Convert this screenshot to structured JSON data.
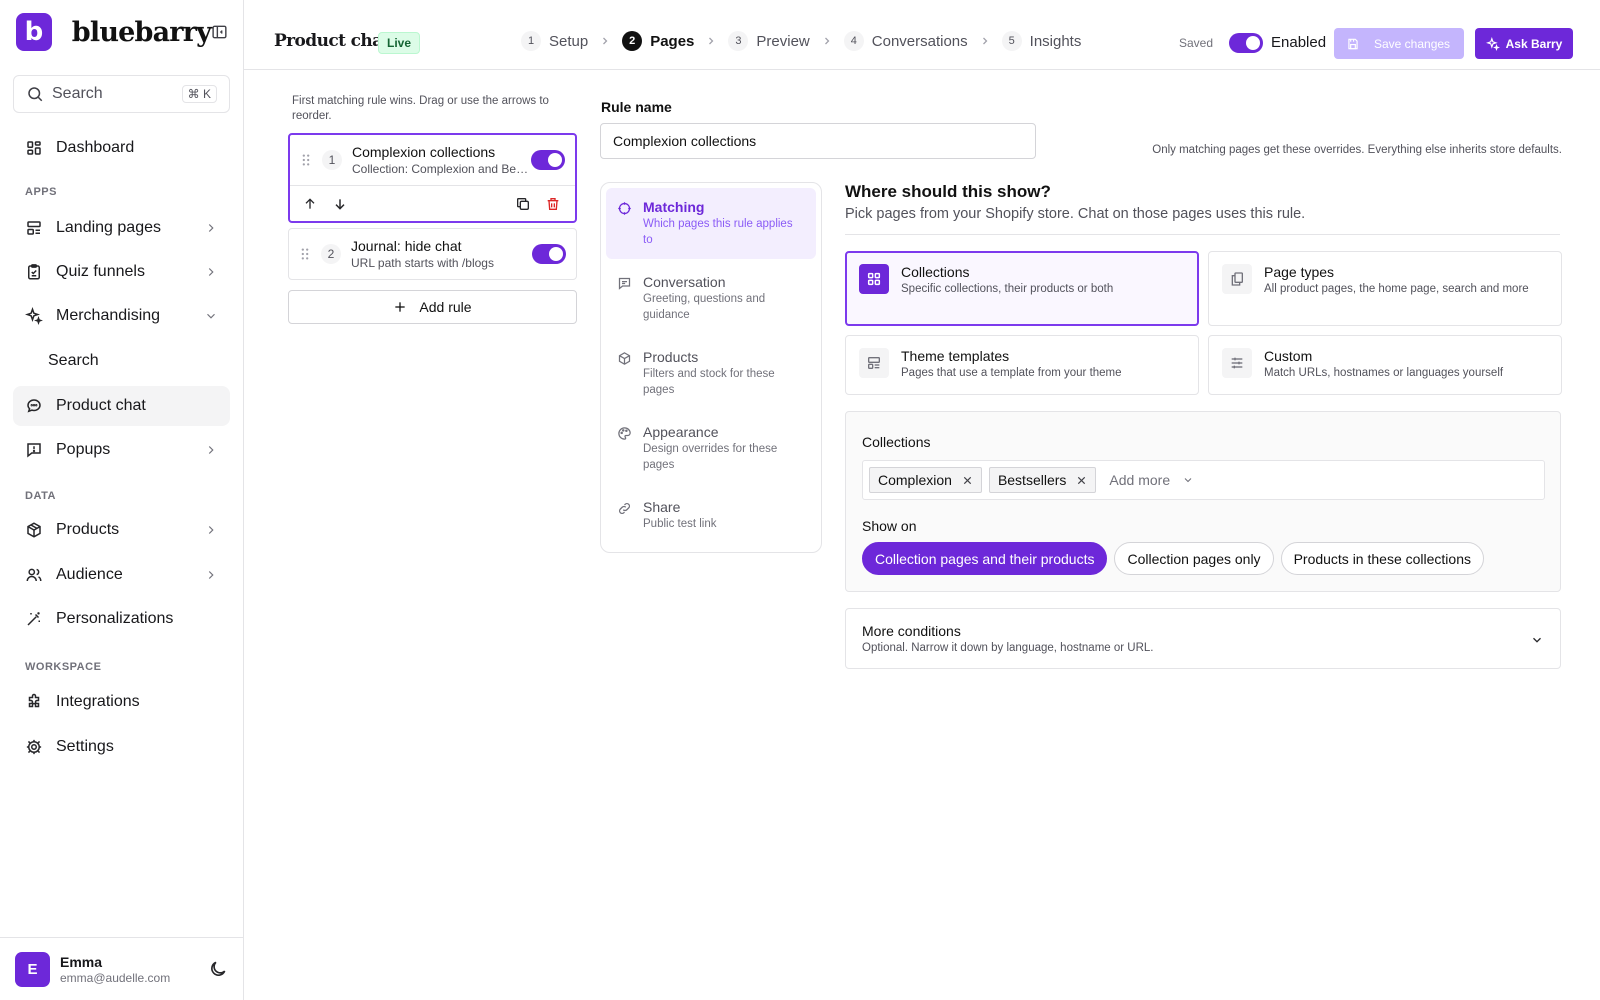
{
  "brand": {
    "logo_letter": "b",
    "name": "bluebarry",
    "accent": "#6d28d9"
  },
  "sidebar": {
    "search": {
      "label": "Search",
      "shortcut": "⌘ K"
    },
    "dashboard": "Dashboard",
    "sections": {
      "apps": "APPS",
      "data": "DATA",
      "workspace": "WORKSPACE"
    },
    "items": {
      "landing_pages": "Landing pages",
      "quiz_funnels": "Quiz funnels",
      "merchandising": "Merchandising",
      "merch_search": "Search",
      "product_chat": "Product chat",
      "popups": "Popups",
      "products": "Products",
      "audience": "Audience",
      "personalizations": "Personalizations",
      "integrations": "Integrations",
      "settings": "Settings"
    },
    "user": {
      "initial": "E",
      "name": "Emma",
      "email": "emma@audelle.com"
    }
  },
  "header": {
    "title": "Product chat",
    "badge": "Live",
    "steps": [
      {
        "num": "1",
        "label": "Setup"
      },
      {
        "num": "2",
        "label": "Pages"
      },
      {
        "num": "3",
        "label": "Preview"
      },
      {
        "num": "4",
        "label": "Conversations"
      },
      {
        "num": "5",
        "label": "Insights"
      }
    ],
    "active_step": 2,
    "saved": "Saved",
    "enabled_label": "Enabled",
    "enabled": true,
    "save_label": "Save changes",
    "ask_label": "Ask Barry"
  },
  "rules": {
    "hint": "First matching rule wins. Drag or use the arrows to reorder.",
    "items": [
      {
        "num": "1",
        "title": "Complexion collections",
        "subtitle": "Collection: Complexion and Bestsellers",
        "enabled": true,
        "selected": true
      },
      {
        "num": "2",
        "title": "Journal: hide chat",
        "subtitle": "URL path starts with /blogs",
        "enabled": true,
        "selected": false
      }
    ],
    "add_label": "Add rule"
  },
  "editor": {
    "name_label": "Rule name",
    "name_value": "Complexion collections",
    "inherit_note": "Only matching pages get these overrides. Everything else inherits store defaults.",
    "sections": [
      {
        "title": "Matching",
        "desc": "Which pages this rule applies to"
      },
      {
        "title": "Conversation",
        "desc": "Greeting, questions and guidance"
      },
      {
        "title": "Products",
        "desc": "Filters and stock for these pages"
      },
      {
        "title": "Appearance",
        "desc": "Design overrides for these pages"
      },
      {
        "title": "Share",
        "desc": "Public test link"
      }
    ],
    "where_title": "Where should this show?",
    "where_sub": "Pick pages from your Shopify store. Chat on those pages uses this rule.",
    "types": [
      {
        "title": "Collections",
        "desc": "Specific collections, their products or both"
      },
      {
        "title": "Page types",
        "desc": "All product pages, the home page, search and more"
      },
      {
        "title": "Theme templates",
        "desc": "Pages that use a template from your theme"
      },
      {
        "title": "Custom",
        "desc": "Match URLs, hostnames or languages yourself"
      }
    ],
    "collections_label": "Collections",
    "tags": [
      "Complexion",
      "Bestsellers"
    ],
    "add_more": "Add more",
    "show_on_label": "Show on",
    "show_on": [
      "Collection pages and their products",
      "Collection pages only",
      "Products in these collections"
    ],
    "more_title": "More conditions",
    "more_desc": "Optional. Narrow it down by language, hostname or URL."
  }
}
